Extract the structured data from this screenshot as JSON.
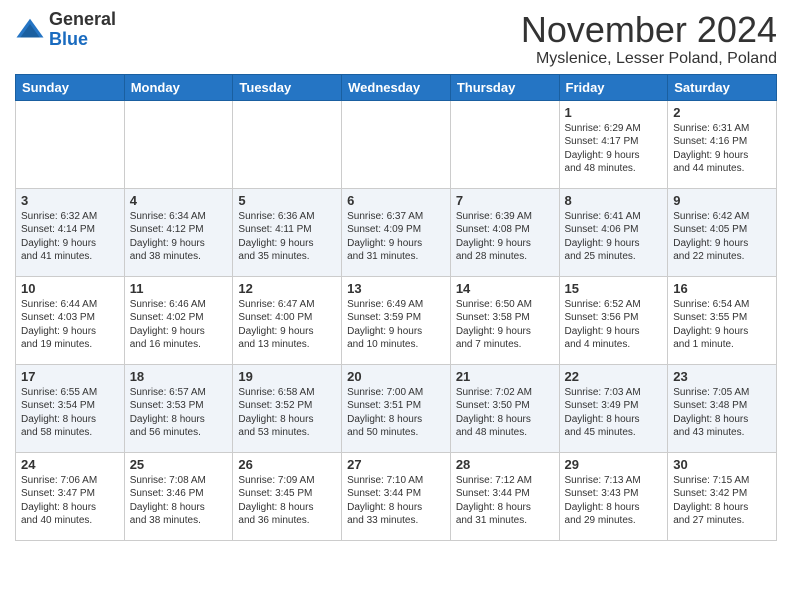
{
  "header": {
    "logo_line1": "General",
    "logo_line2": "Blue",
    "month": "November 2024",
    "location": "Myslenice, Lesser Poland, Poland"
  },
  "weekdays": [
    "Sunday",
    "Monday",
    "Tuesday",
    "Wednesday",
    "Thursday",
    "Friday",
    "Saturday"
  ],
  "weeks": [
    [
      {
        "day": "",
        "text": ""
      },
      {
        "day": "",
        "text": ""
      },
      {
        "day": "",
        "text": ""
      },
      {
        "day": "",
        "text": ""
      },
      {
        "day": "",
        "text": ""
      },
      {
        "day": "1",
        "text": "Sunrise: 6:29 AM\nSunset: 4:17 PM\nDaylight: 9 hours\nand 48 minutes."
      },
      {
        "day": "2",
        "text": "Sunrise: 6:31 AM\nSunset: 4:16 PM\nDaylight: 9 hours\nand 44 minutes."
      }
    ],
    [
      {
        "day": "3",
        "text": "Sunrise: 6:32 AM\nSunset: 4:14 PM\nDaylight: 9 hours\nand 41 minutes."
      },
      {
        "day": "4",
        "text": "Sunrise: 6:34 AM\nSunset: 4:12 PM\nDaylight: 9 hours\nand 38 minutes."
      },
      {
        "day": "5",
        "text": "Sunrise: 6:36 AM\nSunset: 4:11 PM\nDaylight: 9 hours\nand 35 minutes."
      },
      {
        "day": "6",
        "text": "Sunrise: 6:37 AM\nSunset: 4:09 PM\nDaylight: 9 hours\nand 31 minutes."
      },
      {
        "day": "7",
        "text": "Sunrise: 6:39 AM\nSunset: 4:08 PM\nDaylight: 9 hours\nand 28 minutes."
      },
      {
        "day": "8",
        "text": "Sunrise: 6:41 AM\nSunset: 4:06 PM\nDaylight: 9 hours\nand 25 minutes."
      },
      {
        "day": "9",
        "text": "Sunrise: 6:42 AM\nSunset: 4:05 PM\nDaylight: 9 hours\nand 22 minutes."
      }
    ],
    [
      {
        "day": "10",
        "text": "Sunrise: 6:44 AM\nSunset: 4:03 PM\nDaylight: 9 hours\nand 19 minutes."
      },
      {
        "day": "11",
        "text": "Sunrise: 6:46 AM\nSunset: 4:02 PM\nDaylight: 9 hours\nand 16 minutes."
      },
      {
        "day": "12",
        "text": "Sunrise: 6:47 AM\nSunset: 4:00 PM\nDaylight: 9 hours\nand 13 minutes."
      },
      {
        "day": "13",
        "text": "Sunrise: 6:49 AM\nSunset: 3:59 PM\nDaylight: 9 hours\nand 10 minutes."
      },
      {
        "day": "14",
        "text": "Sunrise: 6:50 AM\nSunset: 3:58 PM\nDaylight: 9 hours\nand 7 minutes."
      },
      {
        "day": "15",
        "text": "Sunrise: 6:52 AM\nSunset: 3:56 PM\nDaylight: 9 hours\nand 4 minutes."
      },
      {
        "day": "16",
        "text": "Sunrise: 6:54 AM\nSunset: 3:55 PM\nDaylight: 9 hours\nand 1 minute."
      }
    ],
    [
      {
        "day": "17",
        "text": "Sunrise: 6:55 AM\nSunset: 3:54 PM\nDaylight: 8 hours\nand 58 minutes."
      },
      {
        "day": "18",
        "text": "Sunrise: 6:57 AM\nSunset: 3:53 PM\nDaylight: 8 hours\nand 56 minutes."
      },
      {
        "day": "19",
        "text": "Sunrise: 6:58 AM\nSunset: 3:52 PM\nDaylight: 8 hours\nand 53 minutes."
      },
      {
        "day": "20",
        "text": "Sunrise: 7:00 AM\nSunset: 3:51 PM\nDaylight: 8 hours\nand 50 minutes."
      },
      {
        "day": "21",
        "text": "Sunrise: 7:02 AM\nSunset: 3:50 PM\nDaylight: 8 hours\nand 48 minutes."
      },
      {
        "day": "22",
        "text": "Sunrise: 7:03 AM\nSunset: 3:49 PM\nDaylight: 8 hours\nand 45 minutes."
      },
      {
        "day": "23",
        "text": "Sunrise: 7:05 AM\nSunset: 3:48 PM\nDaylight: 8 hours\nand 43 minutes."
      }
    ],
    [
      {
        "day": "24",
        "text": "Sunrise: 7:06 AM\nSunset: 3:47 PM\nDaylight: 8 hours\nand 40 minutes."
      },
      {
        "day": "25",
        "text": "Sunrise: 7:08 AM\nSunset: 3:46 PM\nDaylight: 8 hours\nand 38 minutes."
      },
      {
        "day": "26",
        "text": "Sunrise: 7:09 AM\nSunset: 3:45 PM\nDaylight: 8 hours\nand 36 minutes."
      },
      {
        "day": "27",
        "text": "Sunrise: 7:10 AM\nSunset: 3:44 PM\nDaylight: 8 hours\nand 33 minutes."
      },
      {
        "day": "28",
        "text": "Sunrise: 7:12 AM\nSunset: 3:44 PM\nDaylight: 8 hours\nand 31 minutes."
      },
      {
        "day": "29",
        "text": "Sunrise: 7:13 AM\nSunset: 3:43 PM\nDaylight: 8 hours\nand 29 minutes."
      },
      {
        "day": "30",
        "text": "Sunrise: 7:15 AM\nSunset: 3:42 PM\nDaylight: 8 hours\nand 27 minutes."
      }
    ]
  ]
}
